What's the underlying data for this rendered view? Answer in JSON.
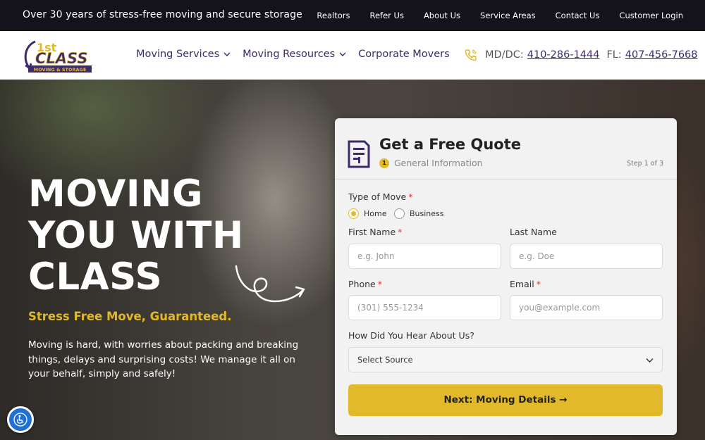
{
  "topbar": {
    "tagline": "Over 30 years of stress-free moving and secure storage",
    "links": [
      "Realtors",
      "Refer Us",
      "About Us",
      "Service Areas",
      "Contact Us",
      "Customer Login"
    ]
  },
  "header": {
    "logo": {
      "big": "1st",
      "brand": "CLASS",
      "sub": "MOVING & STORAGE"
    },
    "nav": [
      {
        "label": "Moving Services",
        "has_dropdown": true
      },
      {
        "label": "Moving Resources",
        "has_dropdown": true
      },
      {
        "label": "Corporate Movers",
        "has_dropdown": false
      }
    ],
    "phones": [
      {
        "label": "MD/DC:",
        "number": "410-286-1444"
      },
      {
        "label": "FL:",
        "number": "407-456-7668"
      }
    ]
  },
  "hero": {
    "title_lines": [
      "MOVING",
      "YOU WITH",
      "CLASS"
    ],
    "subtitle": "Stress Free Move, Guaranteed.",
    "description": "Moving is hard, with worries about packing and breaking things, delays and surprising costs! We manage it all on your behalf, simply and safely!"
  },
  "form": {
    "title": "Get a Free Quote",
    "step_number": "1",
    "step_name": "General Information",
    "step_count": "Step 1 of 3",
    "type_of_move": {
      "label": "Type of Move",
      "options": [
        "Home",
        "Business"
      ],
      "selected": "Home"
    },
    "first_name": {
      "label": "First Name",
      "placeholder": "e.g. John",
      "value": ""
    },
    "last_name": {
      "label": "Last Name",
      "placeholder": "e.g. Doe",
      "value": ""
    },
    "phone": {
      "label": "Phone",
      "placeholder": "(301) 555-1234",
      "value": ""
    },
    "email": {
      "label": "Email",
      "placeholder": "you@example.com",
      "value": ""
    },
    "source": {
      "label": "How Did You Hear About Us?",
      "selected": "Select Source"
    },
    "next_button": "Next: Moving Details →"
  },
  "colors": {
    "brand_purple": "#3f2b6b",
    "accent_gold": "#e3b92c",
    "topbar_bg": "#14121b",
    "a11y_blue": "#1f6fd6"
  },
  "icons": [
    "phone-icon",
    "document-icon",
    "chevron-down-icon",
    "accessibility-icon",
    "squiggle-arrow-icon"
  ]
}
